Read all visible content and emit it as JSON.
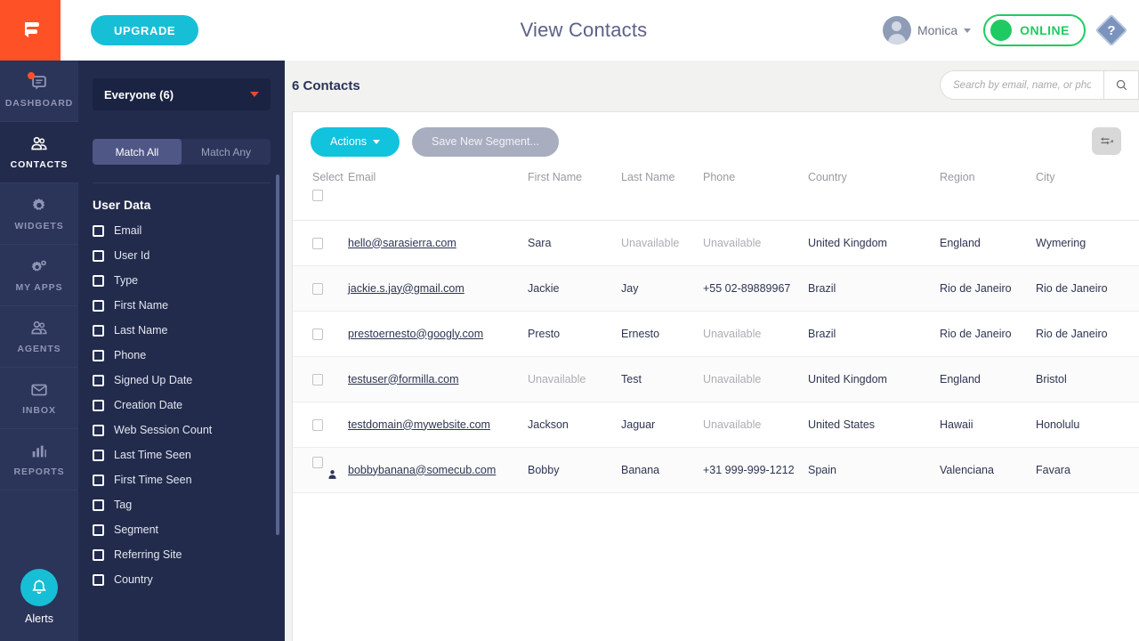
{
  "brand": {
    "logo_name": "formilla-logo",
    "accent_orange": "#ff5126",
    "accent_cyan": "#17bfd6",
    "navy": "#2b3459"
  },
  "topbar": {
    "upgrade_label": "UPGRADE",
    "page_title": "View Contacts",
    "user_name": "Monica",
    "status_label": "ONLINE",
    "help_glyph": "?"
  },
  "rail": {
    "items": [
      {
        "label": "DASHBOARD",
        "icon": "chat-bubble-icon",
        "active": false,
        "badge": true
      },
      {
        "label": "CONTACTS",
        "icon": "contacts-icon",
        "active": true,
        "badge": false
      },
      {
        "label": "WIDGETS",
        "icon": "gear-icon",
        "active": false,
        "badge": false
      },
      {
        "label": "MY APPS",
        "icon": "gears-icon",
        "active": false,
        "badge": false
      },
      {
        "label": "AGENTS",
        "icon": "agents-icon",
        "active": false,
        "badge": false
      },
      {
        "label": "INBOX",
        "icon": "envelope-icon",
        "active": false,
        "badge": false
      },
      {
        "label": "REPORTS",
        "icon": "bar-chart-icon",
        "active": false,
        "badge": false
      }
    ],
    "alerts_label": "Alerts",
    "alerts_icon": "bell-icon"
  },
  "filters": {
    "segment_value": "Everyone (6)",
    "match_all_label": "Match All",
    "match_any_label": "Match Any",
    "match_selected": "Match All",
    "group_title": "User Data",
    "fields": [
      "Email",
      "User Id",
      "Type",
      "First Name",
      "Last Name",
      "Phone",
      "Signed Up Date",
      "Creation Date",
      "Web Session Count",
      "Last Time Seen",
      "First Time Seen",
      "Tag",
      "Segment",
      "Referring Site",
      "Country"
    ]
  },
  "main": {
    "contacts_count_label": "6 Contacts",
    "search_placeholder": "Search by email, name, or phone",
    "search_value": "",
    "actions_label": "Actions",
    "save_segment_label": "Save New Segment...",
    "columns_icon": "column-settings-icon",
    "table": {
      "headers": [
        "Select",
        "Email",
        "First Name",
        "Last Name",
        "Phone",
        "Country",
        "Region",
        "City"
      ],
      "rows": [
        {
          "email": "hello@sarasierra.com",
          "first": "Sara",
          "last": "Unavailable",
          "phone": "Unavailable",
          "country": "United Kingdom",
          "region": "England",
          "city": "Wymering",
          "has_person_icon": false,
          "last_unavail": true,
          "phone_unavail": true,
          "first_unavail": false
        },
        {
          "email": "jackie.s.jay@gmail.com",
          "first": "Jackie",
          "last": "Jay",
          "phone": "+55 02-89889967",
          "country": "Brazil",
          "region": "Rio de Janeiro",
          "city": "Rio de Janeiro",
          "has_person_icon": false,
          "last_unavail": false,
          "phone_unavail": false,
          "first_unavail": false
        },
        {
          "email": "prestoernesto@googly.com",
          "first": "Presto",
          "last": "Ernesto",
          "phone": "Unavailable",
          "country": "Brazil",
          "region": "Rio de Janeiro",
          "city": "Rio de Janeiro",
          "has_person_icon": false,
          "last_unavail": false,
          "phone_unavail": true,
          "first_unavail": false
        },
        {
          "email": "testuser@formilla.com",
          "first": "Unavailable",
          "last": "Test",
          "phone": "Unavailable",
          "country": "United Kingdom",
          "region": "England",
          "city": "Bristol",
          "has_person_icon": false,
          "last_unavail": false,
          "phone_unavail": true,
          "first_unavail": true
        },
        {
          "email": "testdomain@mywebsite.com",
          "first": "Jackson",
          "last": "Jaguar",
          "phone": "Unavailable",
          "country": "United States",
          "region": "Hawaii",
          "city": "Honolulu",
          "has_person_icon": false,
          "last_unavail": false,
          "phone_unavail": true,
          "first_unavail": false
        },
        {
          "email": "bobbybanana@somecub.com",
          "first": "Bobby",
          "last": "Banana",
          "phone": "+31 999-999-1212",
          "country": "Spain",
          "region": "Valenciana",
          "city": "Favara",
          "has_person_icon": true,
          "last_unavail": false,
          "phone_unavail": false,
          "first_unavail": false
        }
      ]
    }
  }
}
